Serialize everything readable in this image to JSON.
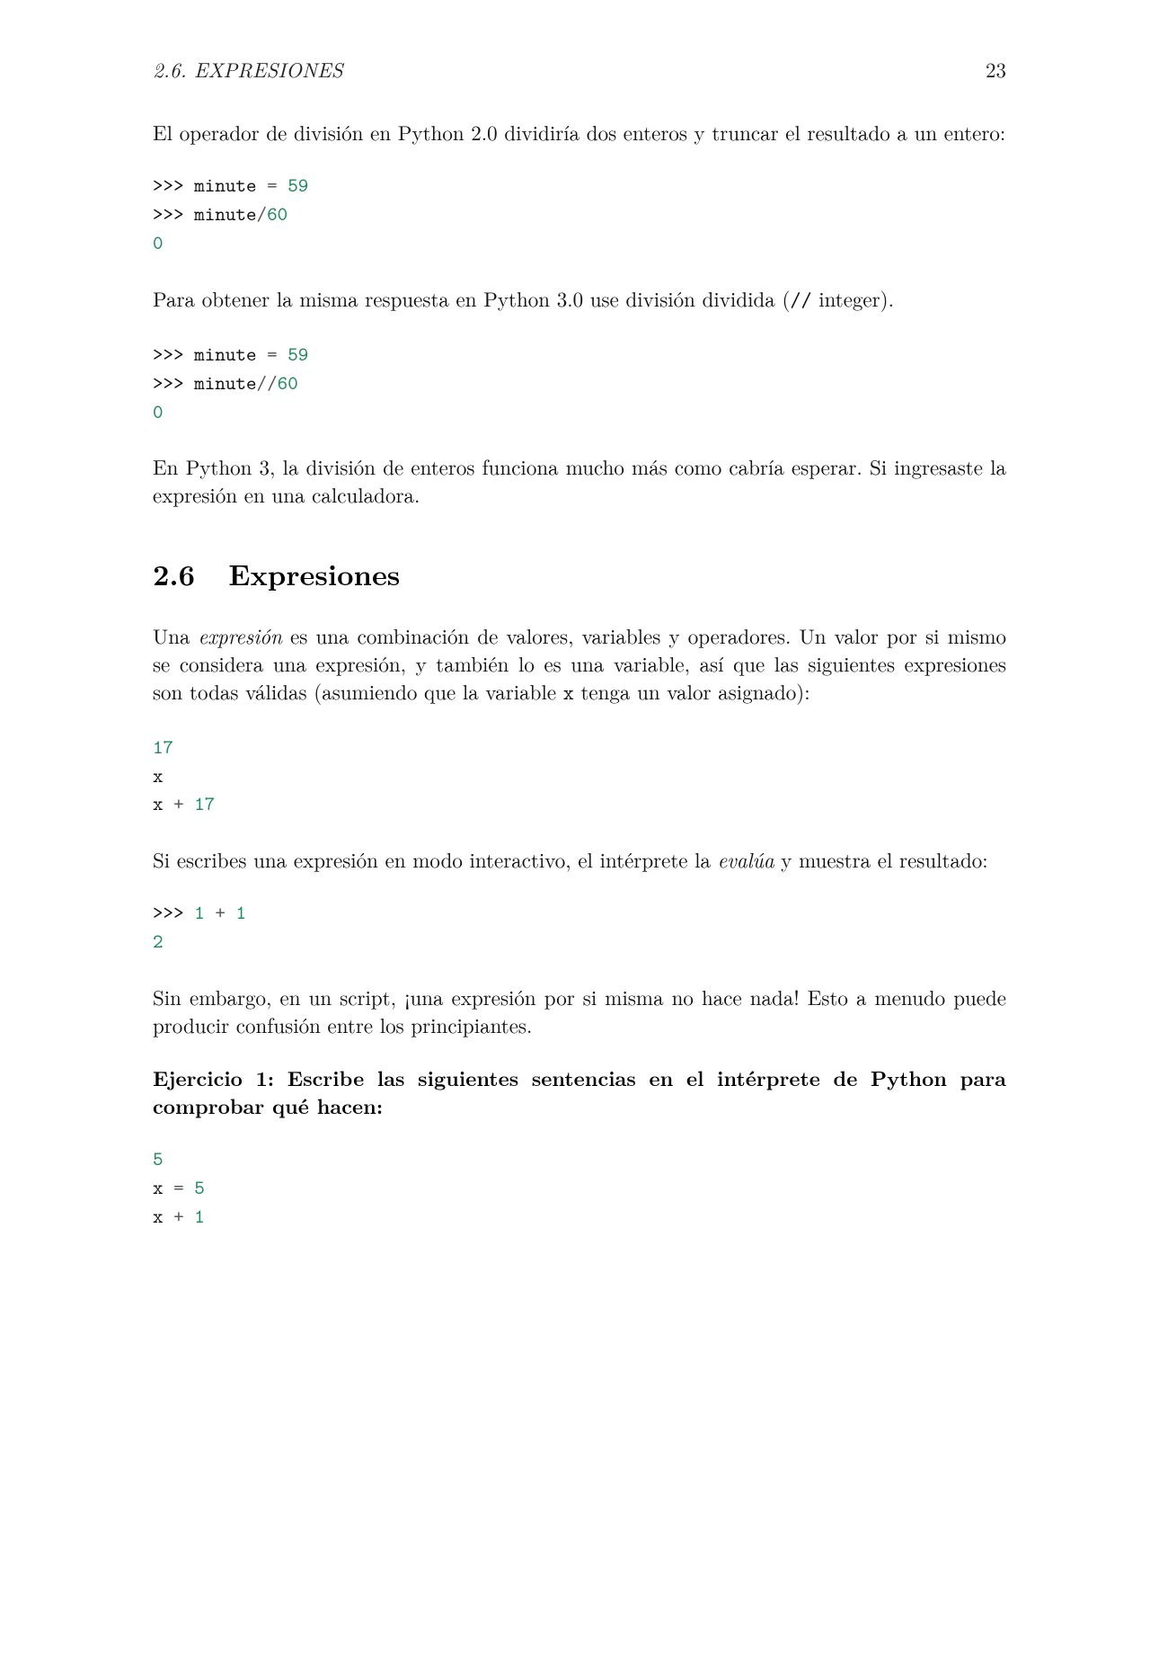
{
  "header": {
    "section_label": "2.6.   EXPRESIONES",
    "page_number": "23"
  },
  "para1": "El operador de división en Python 2.0 dividiría dos enteros y truncar el resultado a un entero:",
  "code1": {
    "prompt": ">>>",
    "var": "minute",
    "eq": "=",
    "n59": "59",
    "slash": "/",
    "n60": "60",
    "result": "0"
  },
  "para2_a": "Para obtener la misma respuesta en Python 3.0 use división dividida (",
  "para2_op": "//",
  "para2_b": " integer).",
  "code2": {
    "prompt": ">>>",
    "var": "minute",
    "eq": "=",
    "n59": "59",
    "dslash": "//",
    "n60": "60",
    "result": "0"
  },
  "para3": "En Python 3, la división de enteros funciona mucho más como cabría esperar. Si ingresaste la expresión en una calculadora.",
  "section": {
    "number": "2.6",
    "title": "Expresiones"
  },
  "para4_a": "Una ",
  "para4_term": "expresión",
  "para4_b": " es una combinación de valores, variables y operadores. Un valor por si mismo se considera una expresión, y también lo es una variable, así que las siguientes expresiones son todas válidas (asumiendo que la variable ",
  "para4_tt": "x",
  "para4_c": " tenga un valor asignado):",
  "code3": {
    "n17": "17",
    "x": "x",
    "plus": "+"
  },
  "para5_a": "Si escribes una expresión en modo interactivo, el intérprete la ",
  "para5_term": "evalúa",
  "para5_b": " y muestra el resultado:",
  "code4": {
    "prompt": ">>>",
    "n1a": "1",
    "plus": "+",
    "n1b": "1",
    "result": "2"
  },
  "para6": "Sin embargo, en un script, ¡una expresión por si misma no hace nada! Esto a menudo puede producir confusión entre los principiantes.",
  "exercise": "Ejercicio 1: Escribe las siguientes sentencias en el intérprete de Python para comprobar qué hacen:",
  "code5": {
    "n5": "5",
    "x": "x",
    "eq": "=",
    "plus": "+",
    "n1": "1"
  }
}
